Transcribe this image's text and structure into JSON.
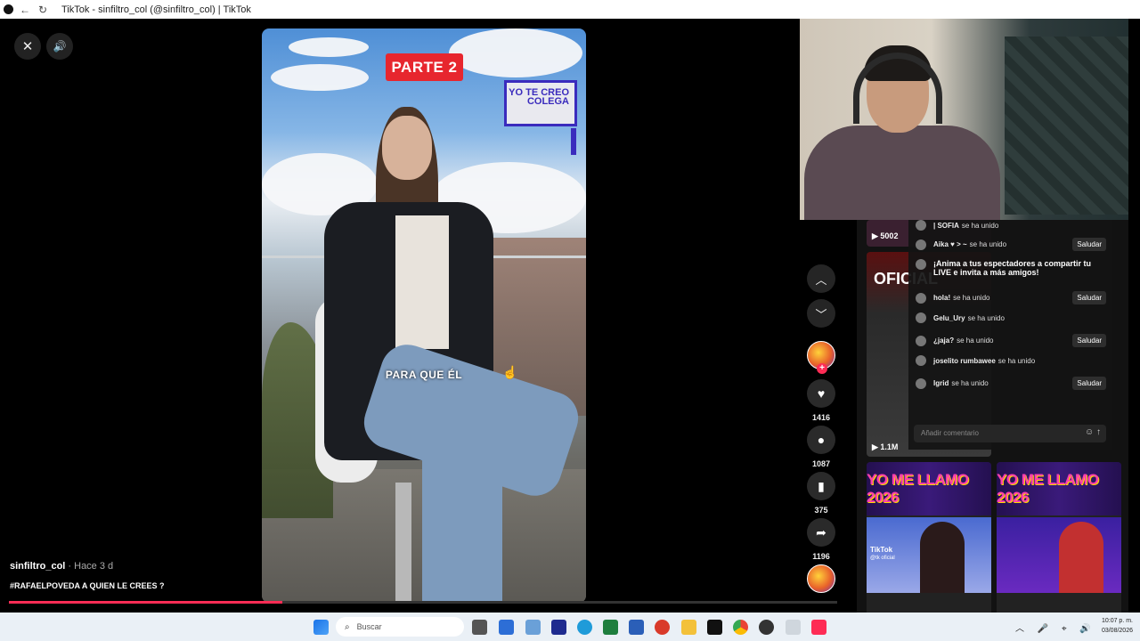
{
  "browser": {
    "title": "TikTok - sinfiltro_col (@sinfiltro_col) | TikTok",
    "back_icon": "←",
    "reload_icon": "↻"
  },
  "player": {
    "close_icon": "✕",
    "volume_icon": "🔊",
    "overlay_tag": "PARTE 2",
    "overlay_sign": "YO TE CREO COLEGA",
    "caption": "PARA QUE ÉL",
    "progress_fraction": 0.33
  },
  "post": {
    "username": "sinfiltro_col",
    "time": "· Hace 3 d",
    "description": "#RAFAELPOVEDA A QUIEN LE CREES ?"
  },
  "actions": {
    "likes": "1416",
    "comments": "1087",
    "saves": "375",
    "shares": "1196"
  },
  "side_thumbs": {
    "top_views": "5002",
    "mid_views": "1.1M",
    "mid_overlay": "OFICIAL",
    "promo_text": "YO ME LLAMO 2026",
    "tiktok_label": "TikTok",
    "tiktok_handle": "@tk oficial"
  },
  "live_chat": {
    "rows": [
      {
        "name": "| SOFIA",
        "text": "se ha unido",
        "saludar": ""
      },
      {
        "name": "Aika ♥ > ~",
        "text": "se ha unido",
        "saludar": "Saludar"
      },
      {
        "name": "",
        "text": "¡Anima a tus espectadores a compartir tu LIVE e invita a más amigos!",
        "saludar": ""
      },
      {
        "name": "hola!",
        "text": "se ha unido",
        "saludar": "Saludar"
      },
      {
        "name": "Gelu_Ury",
        "text": "se ha unido",
        "saludar": ""
      },
      {
        "name": "¿jaja?",
        "text": "se ha unido",
        "saludar": "Saludar"
      },
      {
        "name": "joselito rumbawee",
        "text": "se ha unido",
        "saludar": ""
      },
      {
        "name": "Igrid",
        "text": "se ha unido",
        "saludar": "Saludar"
      }
    ],
    "input_placeholder": "Añadir comentario"
  },
  "taskbar": {
    "search_placeholder": "Buscar",
    "time": "10:07 p. m.",
    "date": "03/08/2026"
  },
  "colors": {
    "accent": "#fe2c55",
    "tag_red": "#e7262e",
    "sign_blue": "#3a2bbd"
  }
}
